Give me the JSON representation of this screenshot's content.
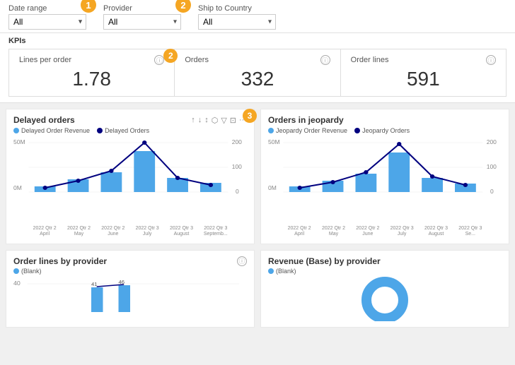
{
  "filters": {
    "date_range": {
      "label": "Date range",
      "value": "All"
    },
    "provider": {
      "label": "Provider",
      "value": "All"
    },
    "ship_to_country": {
      "label": "Ship to Country",
      "value": "All"
    }
  },
  "badges": {
    "b1": "1",
    "b2": "2",
    "b3": "3"
  },
  "kpis": {
    "section_label": "KPIs",
    "cards": [
      {
        "title": "Lines per order",
        "value": "1.78"
      },
      {
        "title": "Orders",
        "value": "332"
      },
      {
        "title": "Order lines",
        "value": "591"
      }
    ]
  },
  "delayed_orders": {
    "title": "Delayed orders",
    "legend": [
      {
        "label": "Delayed Order Revenue",
        "color": "#4da6e8"
      },
      {
        "label": "Delayed Orders",
        "color": "#00007f"
      }
    ],
    "x_labels": [
      "2022 Qtr 2\nApril",
      "2022 Qtr 2\nMay",
      "2022 Qtr 2\nJune",
      "2022 Qtr 3\nJuly",
      "2022 Qtr 3\nAugust",
      "2022 Qtr 3\nSeptemb..."
    ],
    "y_left_max": "50M",
    "y_left_min": "0M",
    "y_right_max": "200",
    "y_right_min": "0",
    "y_right_mid": "100"
  },
  "jeopardy_orders": {
    "title": "Orders in jeopardy",
    "legend": [
      {
        "label": "Jeopardy Order Revenue",
        "color": "#4da6e8"
      },
      {
        "label": "Jeopardy Orders",
        "color": "#00007f"
      }
    ],
    "x_labels": [
      "2022 Qtr 2\nApril",
      "2022 Qtr 2\nMay",
      "2022 Qtr 2\nJune",
      "2022 Qtr 3\nJuly",
      "2022 Qtr 3\nAugust",
      "2022 Qtr 3\nSe..."
    ],
    "y_left_max": "50M",
    "y_left_min": "0M",
    "y_right_max": "200",
    "y_right_min": "0",
    "y_right_mid": "100"
  },
  "order_lines_by_provider": {
    "title": "Order lines by provider",
    "legend": [
      {
        "label": "(Blank)",
        "color": "#4da6e8"
      }
    ],
    "y_label": "40",
    "bars": [
      "41",
      "46"
    ]
  },
  "revenue_by_provider": {
    "title": "Revenue (Base) by provider",
    "legend": [
      {
        "label": "(Blank)",
        "color": "#4da6e8"
      }
    ]
  }
}
